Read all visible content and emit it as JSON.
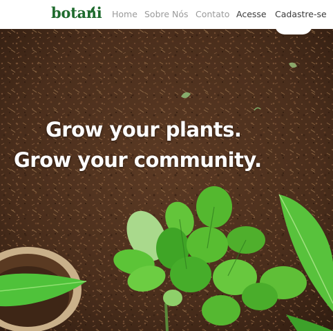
{
  "brand": {
    "name": "botani"
  },
  "nav": {
    "home": "Home",
    "about": "Sobre Nós",
    "contact": "Contato",
    "login": "Acesse",
    "signup": "Cadastre-se"
  },
  "hero": {
    "line1": "Grow your plants.",
    "line2": "Grow your community."
  },
  "colors": {
    "brand_green": "#1f6b2e",
    "soil": "#4a2e1c",
    "leaf_light": "#7fd35a",
    "leaf_dark": "#2e8f2e"
  },
  "icons": [
    "leaf-icon"
  ]
}
